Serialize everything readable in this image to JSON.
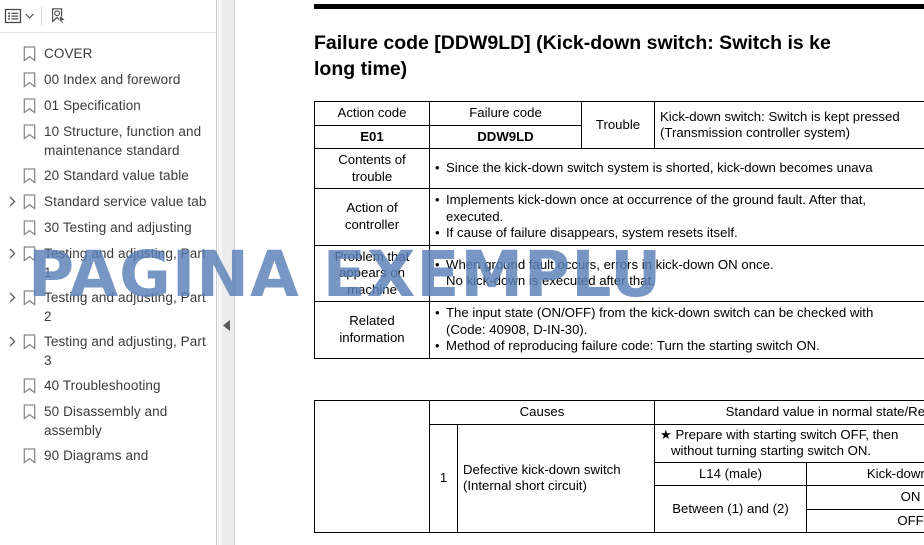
{
  "sidebar": {
    "toolbar": {
      "options_icon": "list-options-icon",
      "options_chevron": "chevron-down-icon",
      "bookmark_pointer_icon": "bookmark-pointer-icon"
    },
    "items": [
      {
        "label": "COVER",
        "expandable": false
      },
      {
        "label": "00 Index and foreword",
        "expandable": false
      },
      {
        "label": "01 Specification",
        "expandable": false
      },
      {
        "label": "10 Structure, function and maintenance standard",
        "expandable": false
      },
      {
        "label": "20 Standard value table",
        "expandable": false
      },
      {
        "label": "Standard service value tab",
        "expandable": true
      },
      {
        "label": "30 Testing and adjusting",
        "expandable": false
      },
      {
        "label": "Testing and adjusting, Part 1",
        "expandable": true
      },
      {
        "label": "Testing and adjusting, Part 2",
        "expandable": true
      },
      {
        "label": "Testing and adjusting, Part 3",
        "expandable": true
      },
      {
        "label": "40 Troubleshooting",
        "expandable": false
      },
      {
        "label": "50 Disassembly and assembly",
        "expandable": false
      },
      {
        "label": "90 Diagrams and",
        "expandable": false
      }
    ],
    "collapse_handle_icon": "collapse-left-icon"
  },
  "document": {
    "title_line1": "Failure code [DDW9LD] (Kick-down switch: Switch is ke",
    "title_line2": "long time)",
    "table1": {
      "h_action_code": "Action code",
      "h_failure_code": "Failure code",
      "h_trouble": "Trouble",
      "v_action_code": "E01",
      "v_failure_code": "DDW9LD",
      "trouble_line1": "Kick-down switch: Switch is kept pressed",
      "trouble_line2": "(Transmission controller system)",
      "r_contents_label": "Contents of trouble",
      "r_contents_text": "Since the kick-down switch system is shorted, kick-down becomes unava",
      "r_action_label": "Action of controller",
      "r_action_text1": "Implements kick-down once at occurrence of the ground fault. After that,",
      "r_action_text1b": "executed.",
      "r_action_text2": "If cause of failure disappears, system resets itself.",
      "r_problem_label": "Problem that appears on machine",
      "r_problem_text1": "When ground fault occurs, errors in kick-down ON once.",
      "r_problem_text2": "No kick-down is executed after that.",
      "r_related_label": "Related information",
      "r_related_text1": "The input state (ON/OFF) from the kick-down switch can be checked with",
      "r_related_text1b": "(Code: 40908, D-IN-30).",
      "r_related_text2": "Method of reproducing failure code: Turn the starting switch ON."
    },
    "table2": {
      "h_causes": "Causes",
      "h_standard": "Standard value in normal state/Rema",
      "note_line1": "★ Prepare with starting switch OFF, then",
      "note_line2": "without turning starting switch ON.",
      "sub_h_left": "L14 (male)",
      "sub_h_right": "Kick-down swit",
      "row_number": "1",
      "row_cause_line1": "Defective kick-down switch",
      "row_cause_line2": "(Internal short circuit)",
      "sub_left_value": "Between (1) and (2)",
      "sub_right_value_1": "ON",
      "sub_right_value_2": "OFF"
    }
  },
  "watermark": {
    "text": "PAGINA EXEMPLU",
    "color": "#5a80b8"
  }
}
